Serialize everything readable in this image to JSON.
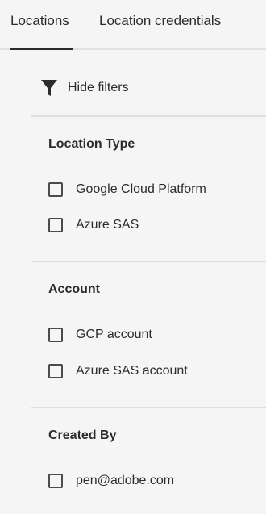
{
  "tabs": {
    "locations": "Locations",
    "credentials": "Location credentials"
  },
  "filter_toggle": {
    "label": "Hide filters",
    "icon": "funnel-icon"
  },
  "sections": {
    "location_type": {
      "title": "Location Type",
      "options": [
        "Google Cloud Platform",
        "Azure SAS"
      ]
    },
    "account": {
      "title": "Account",
      "options": [
        "GCP account",
        "Azure SAS account"
      ]
    },
    "created_by": {
      "title": "Created By",
      "options": [
        "pen@adobe.com"
      ]
    }
  },
  "colors": {
    "background": "#f5f5f5",
    "text": "#2c2c2c",
    "divider": "#dedede",
    "active_tab_indicator": "#2c2c2c"
  }
}
